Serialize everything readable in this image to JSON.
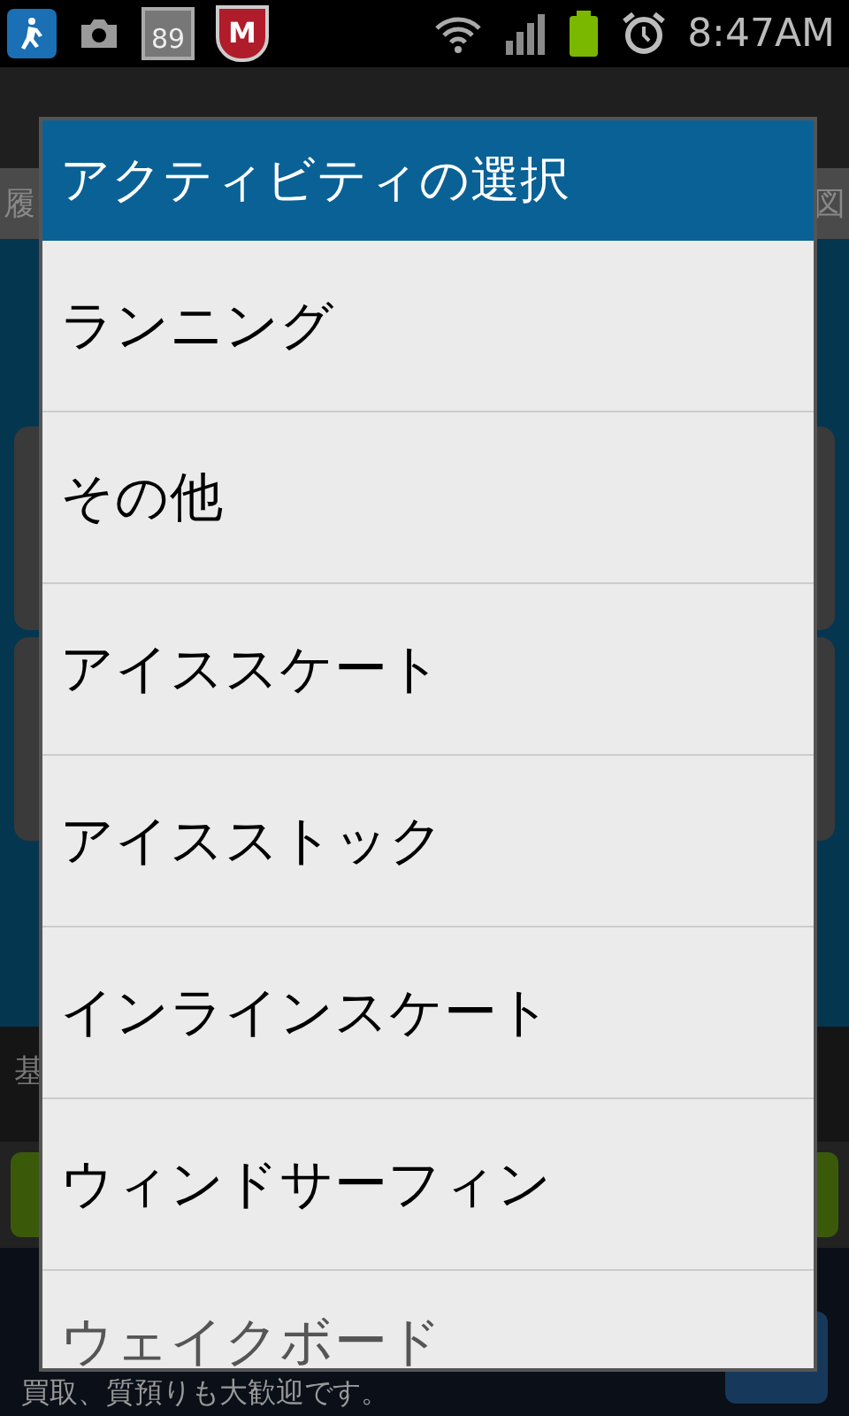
{
  "status_bar": {
    "time": "8:47AM",
    "battery_badge": "89",
    "shield_letter": "M"
  },
  "background": {
    "tab_left": "履",
    "tab_right": "図",
    "section_label": "基",
    "ad_line_3": "買取、質預りも大歓迎です。"
  },
  "dialog": {
    "title": "アクティビティの選択",
    "items": [
      {
        "label": "ランニング"
      },
      {
        "label": "その他"
      },
      {
        "label": "アイススケート"
      },
      {
        "label": "アイスストック"
      },
      {
        "label": "インラインスケート"
      },
      {
        "label": "ウィンドサーフィン"
      },
      {
        "label": "ウェイクボード"
      }
    ]
  }
}
